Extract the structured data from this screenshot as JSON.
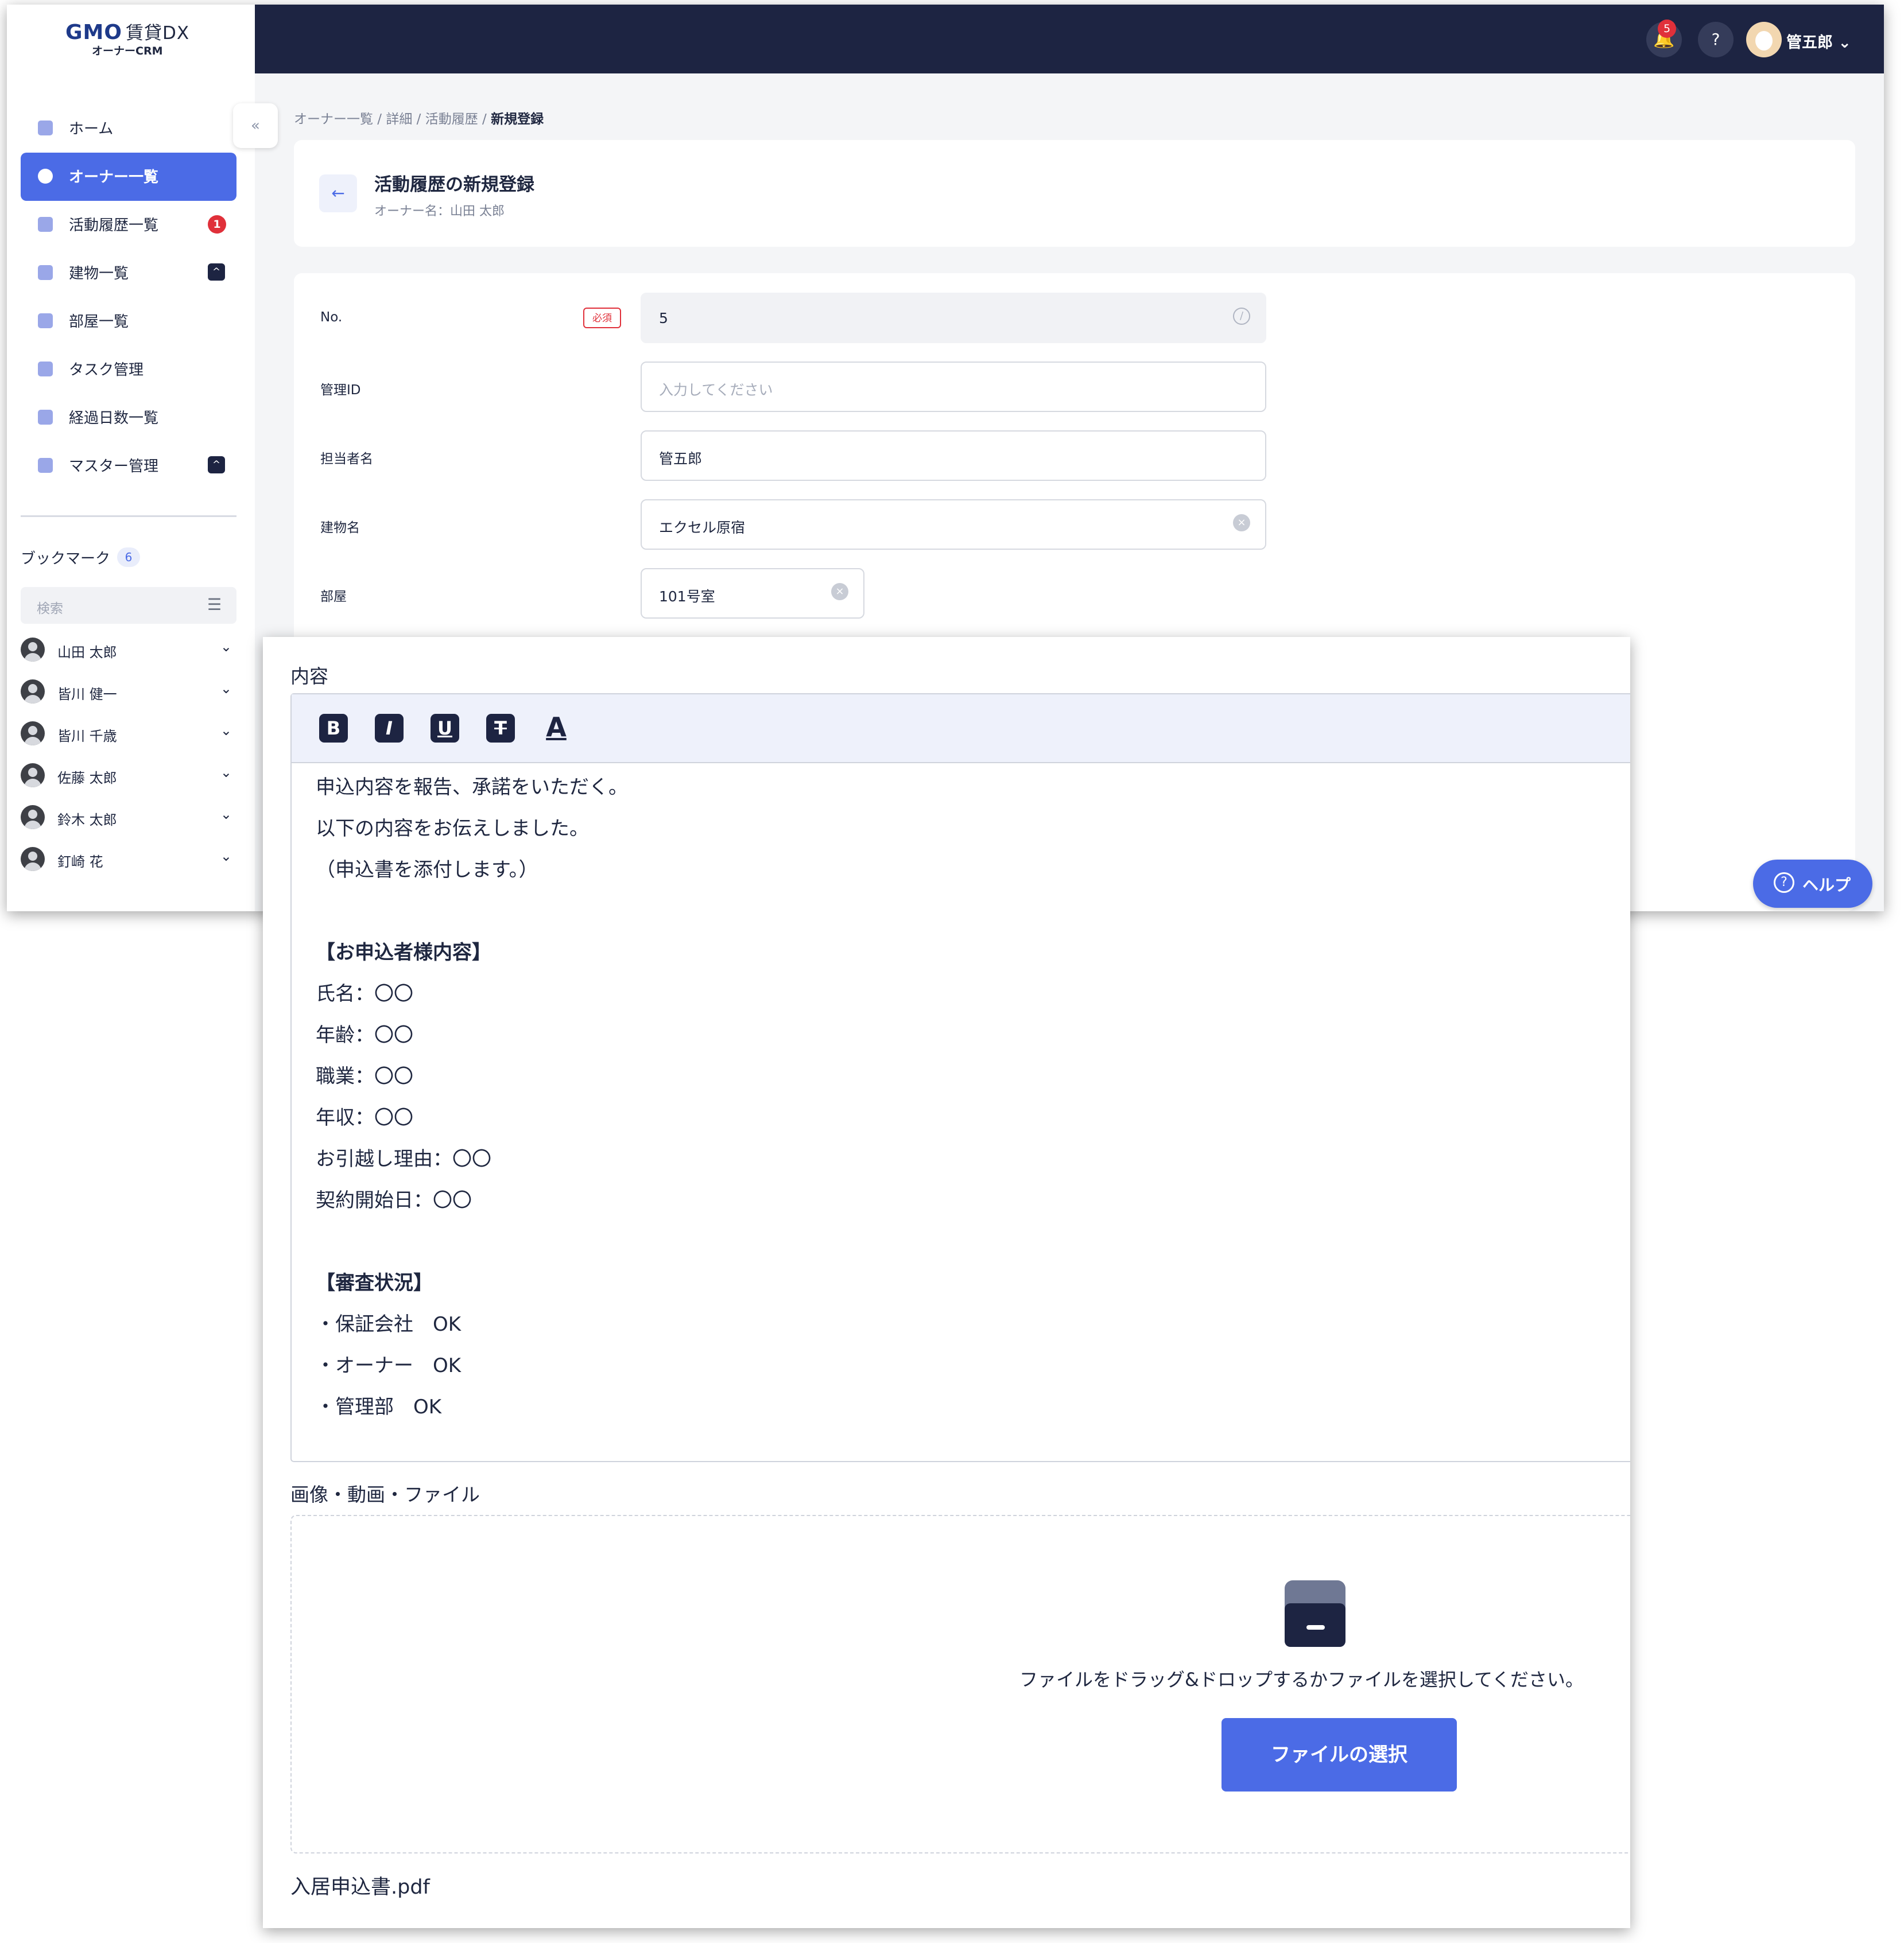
{
  "logo": {
    "brand": "GMO",
    "product": "賃貸DX",
    "sub": "オーナーCRM"
  },
  "topbar": {
    "notification_count": "5",
    "user_name": "管五郎",
    "help_glyph": "?"
  },
  "sidebar": {
    "items": [
      {
        "label": "ホーム",
        "icon": "home-icon"
      },
      {
        "label": "オーナー一覧",
        "icon": "owner-icon",
        "active": true
      },
      {
        "label": "活動履歴一覧",
        "icon": "activity-icon",
        "badge": "1"
      },
      {
        "label": "建物一覧",
        "icon": "building-icon",
        "expand": "^"
      },
      {
        "label": "部屋一覧",
        "icon": "room-icon"
      },
      {
        "label": "タスク管理",
        "icon": "task-icon"
      },
      {
        "label": "経過日数一覧",
        "icon": "days-icon"
      },
      {
        "label": "マスター管理",
        "icon": "master-icon",
        "expand": "^"
      }
    ],
    "bookmarks": {
      "title": "ブックマーク",
      "count": "6",
      "search_placeholder": "検索",
      "items": [
        "山田 太郎",
        "皆川 健一",
        "皆川 千歳",
        "佐藤 太郎",
        "鈴木 太郎",
        "釘崎 花"
      ]
    }
  },
  "breadcrumb": {
    "parts": [
      "オーナー一覧",
      "詳細",
      "活動履歴"
    ],
    "separator": " / ",
    "current": "新規登録"
  },
  "header": {
    "title": "活動履歴の新規登録",
    "subtitle": "オーナー名：山田 太郎"
  },
  "form": {
    "no_label": "No.",
    "required_label": "必須",
    "no_value": "5",
    "mgmt_id_label": "管理ID",
    "mgmt_id_placeholder": "入力してください",
    "staff_label": "担当者名",
    "staff_value": "管五郎",
    "building_label": "建物名",
    "building_value": "エクセル原宿",
    "room_label": "部屋",
    "room_value": "101号室"
  },
  "help_button": {
    "label": "ヘルプ"
  },
  "editor": {
    "label": "内容",
    "toolbar": [
      "B",
      "I",
      "U",
      "T",
      "A"
    ],
    "lines": [
      "申込内容を報告、承諾をいただく。",
      "以下の内容をお伝えしました。",
      "（申込書を添付します。）",
      "",
      "【お申込者様内容】",
      "氏名：〇〇",
      "年齢：〇〇",
      "職業：〇〇",
      "年収：〇〇",
      "お引越し理由：〇〇",
      "契約開始日：〇〇",
      "",
      "【審査状況】",
      "・保証会社　OK",
      "・オーナー　OK",
      "・管理部　OK"
    ]
  },
  "upload": {
    "label": "画像・動画・ファイル",
    "instructions": "ファイルをドラッグ&ドロップするかファイルを選択してください。",
    "button": "ファイルの選択",
    "attached_file": "入居申込書.pdf"
  },
  "colors": {
    "accent": "#4b6be6",
    "navy": "#1d2442",
    "danger": "#e0303a"
  }
}
